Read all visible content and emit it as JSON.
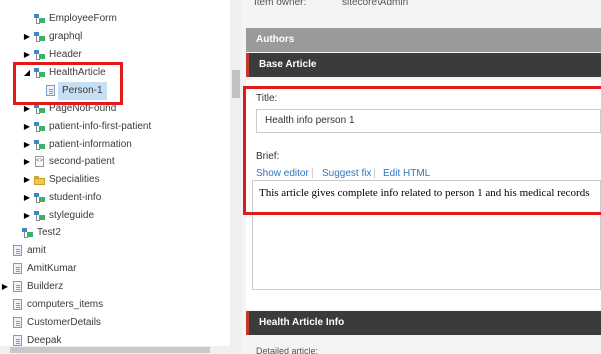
{
  "tree": {
    "items": [
      {
        "label": "EmployeeForm",
        "icon": "template-icon",
        "arrow": ""
      },
      {
        "label": "graphql",
        "icon": "template-icon",
        "arrow": "▶"
      },
      {
        "label": "Header",
        "icon": "template-icon",
        "arrow": "▶"
      },
      {
        "label": "HealthArticle",
        "icon": "template-icon",
        "arrow": "◢"
      },
      {
        "label": "Person-1",
        "icon": "document-icon",
        "arrow": ""
      },
      {
        "label": "PageNotFound",
        "icon": "template-icon",
        "arrow": "▶"
      },
      {
        "label": "patient-info-first-patient",
        "icon": "template-icon",
        "arrow": "▶"
      },
      {
        "label": "patient-information",
        "icon": "template-icon",
        "arrow": "▶"
      },
      {
        "label": "second-patient",
        "icon": "code-icon",
        "arrow": "▶"
      },
      {
        "label": "Specialities",
        "icon": "folder-icon",
        "arrow": "▶"
      },
      {
        "label": "student-info",
        "icon": "template-icon",
        "arrow": "▶"
      },
      {
        "label": "styleguide",
        "icon": "template-icon",
        "arrow": "▶"
      },
      {
        "label": "Test2",
        "icon": "template-icon",
        "arrow": ""
      },
      {
        "label": "amit",
        "icon": "document-icon",
        "arrow": ""
      },
      {
        "label": "AmitKumar",
        "icon": "document-icon",
        "arrow": ""
      },
      {
        "label": "Builderz",
        "icon": "document-icon",
        "arrow": "▶"
      },
      {
        "label": "computers_items",
        "icon": "document-icon",
        "arrow": ""
      },
      {
        "label": "CustomerDetails",
        "icon": "document-icon",
        "arrow": ""
      },
      {
        "label": "Deepak",
        "icon": "document-icon",
        "arrow": ""
      }
    ]
  },
  "editor": {
    "item_owner_label": "Item owner:",
    "item_owner_value": "sitecore\\Admin",
    "sections": {
      "authors": "Authors",
      "base_article": "Base Article",
      "health_article_info": "Health Article Info"
    },
    "title_label": "Title:",
    "title_value": "Health info person 1",
    "brief_label": "Brief:",
    "rte_links": {
      "show_editor": "Show editor",
      "suggest_fix": "Suggest fix",
      "edit_html": "Edit HTML",
      "separator": "|"
    },
    "brief_value": "This article gives complete info related to person 1 and his medical records",
    "detailed_label": "Detailed article:"
  },
  "colors": {
    "highlight": "#e01a1a",
    "link": "#2f75c0",
    "section_dark": "#3b3b3b",
    "section_grey": "#9a9a9a"
  }
}
